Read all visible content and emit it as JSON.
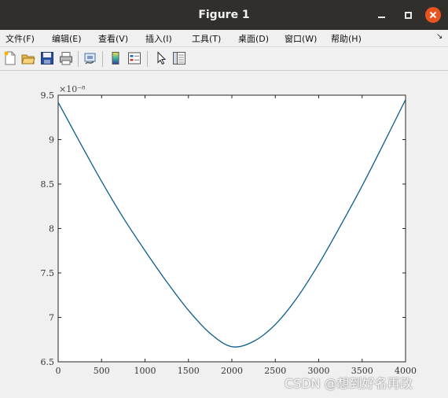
{
  "window": {
    "title": "Figure 1"
  },
  "menubar": {
    "items": [
      "文件(F)",
      "编辑(E)",
      "查看(V)",
      "插入(I)",
      "工具(T)",
      "桌面(D)",
      "窗口(W)",
      "帮助(H)"
    ],
    "dock_glyph": "↘"
  },
  "toolbar": {
    "icons": [
      "new-figure-icon",
      "open-file-icon",
      "save-icon",
      "print-icon",
      "link-plot-icon",
      "colorbar-icon",
      "legend-icon",
      "edit-plot-arrow-icon",
      "property-inspector-icon"
    ]
  },
  "colors": {
    "line": "#0b5d8c",
    "titlebar": "#302f2c",
    "close": "#e95420"
  },
  "chart_data": {
    "type": "line",
    "title": "",
    "xlabel": "",
    "ylabel": "",
    "exponent_label": "×10⁻⁸",
    "xlim": [
      0,
      4000
    ],
    "ylim": [
      6.5,
      9.5
    ],
    "x_ticks": [
      0,
      500,
      1000,
      1500,
      2000,
      2500,
      3000,
      3500,
      4000
    ],
    "y_ticks": [
      6.5,
      7,
      7.5,
      8,
      8.5,
      9,
      9.5
    ],
    "y_tick_labels": [
      "6.5",
      "7",
      "7.5",
      "8",
      "8.5",
      "9",
      "9.5"
    ],
    "grid": false,
    "series": [
      {
        "x": [
          0,
          250,
          500,
          750,
          1000,
          1250,
          1500,
          1750,
          2000,
          2250,
          2500,
          2750,
          3000,
          3250,
          3500,
          3750,
          4000
        ],
        "y": [
          9.42,
          8.97,
          8.53,
          8.12,
          7.75,
          7.4,
          7.08,
          6.82,
          6.67,
          6.73,
          6.92,
          7.22,
          7.6,
          8.03,
          8.48,
          8.96,
          9.45
        ]
      }
    ]
  },
  "watermark": "CSDN @想到好名再改"
}
